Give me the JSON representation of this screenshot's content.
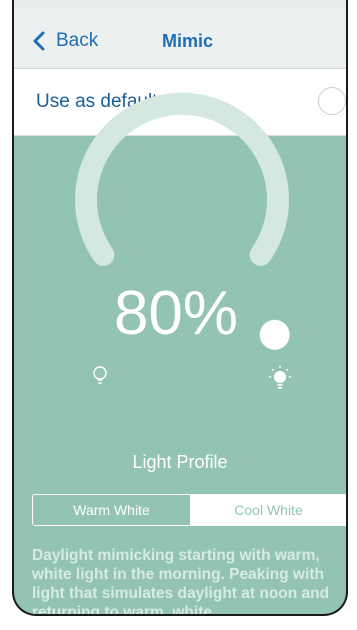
{
  "nav": {
    "back_label": "Back",
    "title": "Mimic"
  },
  "default_scene": {
    "label": "Use as default scene",
    "checked": false
  },
  "dial": {
    "percent_label": "80%",
    "level": 0.8,
    "left_icon": "bulb-outline-icon",
    "right_icon": "bulb-lit-icon"
  },
  "profile": {
    "label": "Light Profile",
    "options": [
      "Warm White",
      "Cool White"
    ],
    "selected": "Cool White"
  },
  "description": "Daylight mimicking starting with warm, white light in the morning. Peaking with light that simulates daylight at noon and returning to warm, white",
  "colors": {
    "background": "#93c4b2",
    "accent": "#1f6fb2",
    "track": "#d4e8df",
    "white": "#ffffff"
  }
}
